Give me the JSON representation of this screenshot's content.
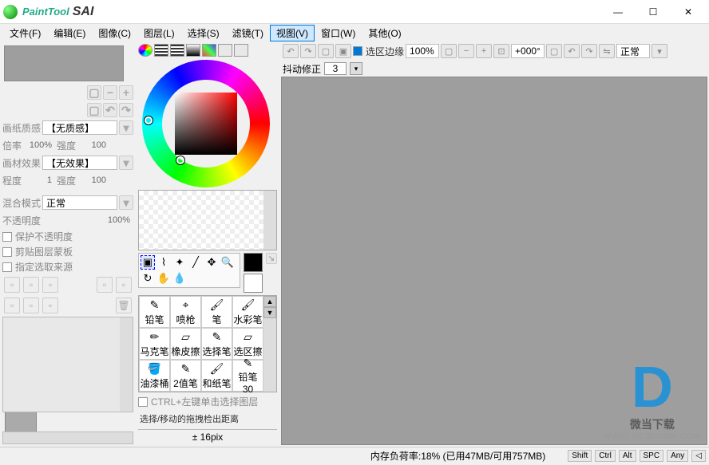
{
  "app": {
    "name1": "PaintTool",
    "name2": "SAI"
  },
  "window": {
    "min": "—",
    "max": "☐",
    "close": "✕"
  },
  "menu": {
    "file": "文件(F)",
    "edit": "编辑(E)",
    "image": "图像(C)",
    "layer": "图层(L)",
    "select": "选择(S)",
    "filter": "滤镜(T)",
    "view": "视图(V)",
    "window": "窗口(W)",
    "other": "其他(O)"
  },
  "left": {
    "label_texture": "画纸质感",
    "texture_val": "【无质感】",
    "label_zoom": "倍率",
    "zoom_val": "100%",
    "label_strength": "强度",
    "strength_val": "100",
    "label_effect": "画材效果",
    "effect_val": "【无效果】",
    "label_degree": "程度",
    "degree_val": "1",
    "strength2_val": "100",
    "label_blend": "混合模式",
    "blend_val": "正常",
    "label_opacity": "不透明度",
    "opacity_val": "100%",
    "chk_protect": "保护不透明度",
    "chk_clip": "剪贴图层蒙板",
    "chk_source": "指定选取来源"
  },
  "mid": {
    "brushes": [
      "铅笔",
      "喷枪",
      "笔",
      "水彩笔",
      "马克笔",
      "橡皮擦",
      "选择笔",
      "选区擦",
      "油漆桶",
      "2值笔",
      "和纸笔",
      "铅笔30"
    ],
    "chk_ctrl": "CTRL+左键单击选择图层",
    "drag_label": "选择/移动的拖拽检出距离",
    "size_val": "± 16pix"
  },
  "canvasbar": {
    "chk_seledge": "选区边缘",
    "zoom": "100%",
    "angle": "+000°",
    "mode": "正常"
  },
  "stabilizer": {
    "label": "抖动修正",
    "value": "3"
  },
  "status": {
    "memory": "内存负荷率:18% (已用47MB/可用757MB)",
    "keys": [
      "Shift",
      "Ctrl",
      "Alt",
      "SPC",
      "Any"
    ],
    "arrow": "◁"
  },
  "watermark": {
    "text": "微当下载",
    "url": "WWW.WEIDOWN.COM"
  }
}
